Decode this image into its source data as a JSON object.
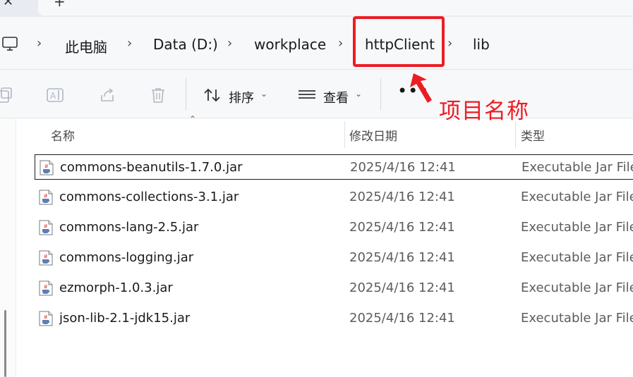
{
  "titlebar": {
    "close_glyph": "✕",
    "new_tab_glyph": "+"
  },
  "breadcrumb": {
    "items": [
      "此电脑",
      "Data (D:)",
      "workplace",
      "httpClient",
      "lib"
    ],
    "separator": "›"
  },
  "toolbar": {
    "sort_label": "排序",
    "view_label": "查看",
    "more_label": "•••"
  },
  "columns": {
    "name": "名称",
    "date": "修改日期",
    "type": "类型"
  },
  "files": [
    {
      "name": "commons-beanutils-1.7.0.jar",
      "date": "2025/4/16 12:41",
      "type": "Executable Jar File"
    },
    {
      "name": "commons-collections-3.1.jar",
      "date": "2025/4/16 12:41",
      "type": "Executable Jar File"
    },
    {
      "name": "commons-lang-2.5.jar",
      "date": "2025/4/16 12:41",
      "type": "Executable Jar File"
    },
    {
      "name": "commons-logging.jar",
      "date": "2025/4/16 12:41",
      "type": "Executable Jar File"
    },
    {
      "name": "ezmorph-1.0.3.jar",
      "date": "2025/4/16 12:41",
      "type": "Executable Jar File"
    },
    {
      "name": "json-lib-2.1-jdk15.jar",
      "date": "2025/4/16 12:41",
      "type": "Executable Jar File"
    }
  ],
  "annotation": {
    "text": "项目名称",
    "color": "#ee1c24"
  },
  "icons": {
    "pc": "computer-icon",
    "copy": "copy-icon",
    "rename": "rename-icon",
    "share": "share-icon",
    "delete": "delete-icon",
    "sort": "sort-icon",
    "view": "view-icon",
    "jar": "java-jar-icon"
  }
}
